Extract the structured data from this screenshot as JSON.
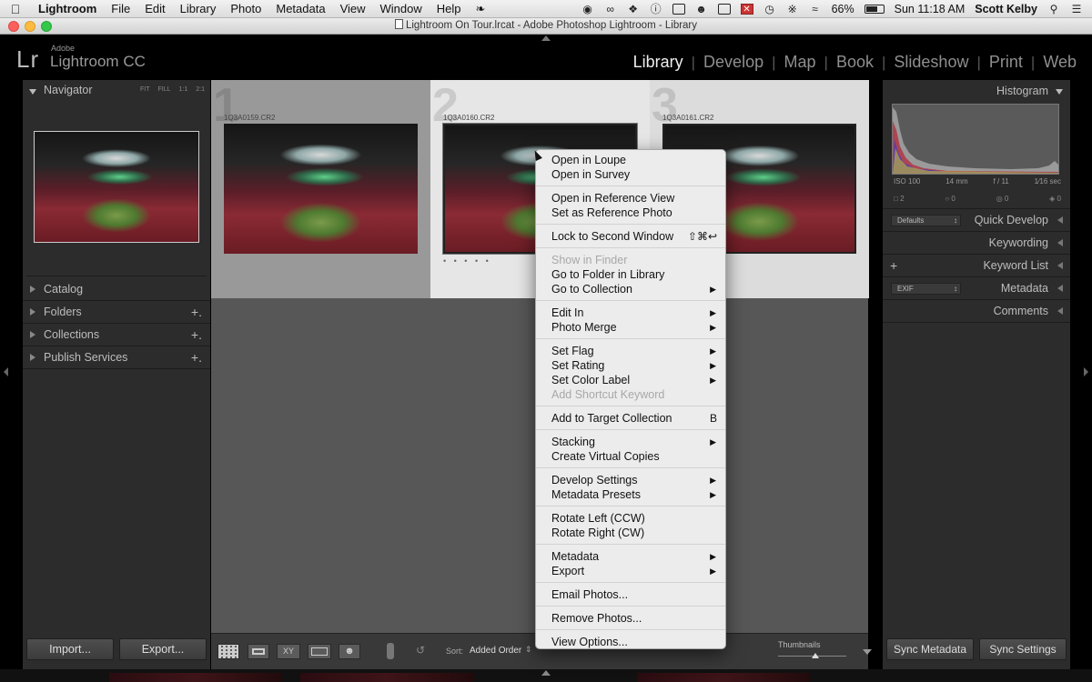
{
  "menubar": {
    "app": "Lightroom",
    "items": [
      "File",
      "Edit",
      "Library",
      "Photo",
      "Metadata",
      "View",
      "Window",
      "Help"
    ],
    "battery": "66%",
    "clock": "Sun 11:18 AM",
    "user": "Scott Kelby"
  },
  "window": {
    "title": "Lightroom On Tour.lrcat - Adobe Photoshop Lightroom - Library"
  },
  "identity": {
    "logo": "Lr",
    "adobe": "Adobe",
    "product": "Lightroom CC"
  },
  "modules": [
    "Library",
    "Develop",
    "Map",
    "Book",
    "Slideshow",
    "Print",
    "Web"
  ],
  "active_module": "Library",
  "left_panel": {
    "navigator": {
      "title": "Navigator",
      "zoom": [
        "FIT",
        "FILL",
        "1:1",
        "2:1"
      ]
    },
    "sections": [
      {
        "label": "Catalog",
        "plus": ""
      },
      {
        "label": "Folders",
        "plus": "+."
      },
      {
        "label": "Collections",
        "plus": "+."
      },
      {
        "label": "Publish Services",
        "plus": "+."
      }
    ],
    "import_label": "Import...",
    "export_label": "Export..."
  },
  "grid": {
    "cells": [
      {
        "index": "1",
        "filename": "1Q3A0159.CR2",
        "dots": ""
      },
      {
        "index": "2",
        "filename": "1Q3A0160.CR2",
        "dots": "• • • • •"
      },
      {
        "index": "3",
        "filename": "1Q3A0161.CR2",
        "dots": ""
      }
    ]
  },
  "toolbar": {
    "sort_label": "Sort:",
    "sort_value": "Added Order",
    "thumbnails_label": "Thumbnails"
  },
  "right_panel": {
    "histogram": {
      "title": "Histogram",
      "exif": [
        "ISO 100",
        "14 mm",
        "f / 11",
        "1⁄16 sec"
      ],
      "tools": [
        "2",
        "0",
        "0",
        "0"
      ]
    },
    "quick_develop": {
      "title": "Quick Develop",
      "preset": "Defaults"
    },
    "keywording": "Keywording",
    "keyword_list": "Keyword List",
    "metadata": {
      "title": "Metadata",
      "preset": "EXIF"
    },
    "comments": "Comments",
    "sync_metadata_label": "Sync Metadata",
    "sync_settings_label": "Sync Settings"
  },
  "context_menu": {
    "groups": [
      [
        {
          "label": "Open in Loupe"
        },
        {
          "label": "Open in Survey"
        }
      ],
      [
        {
          "label": "Open in Reference View"
        },
        {
          "label": "Set as Reference Photo"
        }
      ],
      [
        {
          "label": "Lock to Second Window",
          "shortcut": "⇧⌘↩"
        }
      ],
      [
        {
          "label": "Show in Finder",
          "disabled": true
        },
        {
          "label": "Go to Folder in Library"
        },
        {
          "label": "Go to Collection",
          "submenu": true
        }
      ],
      [
        {
          "label": "Edit In",
          "submenu": true
        },
        {
          "label": "Photo Merge",
          "submenu": true
        }
      ],
      [
        {
          "label": "Set Flag",
          "submenu": true
        },
        {
          "label": "Set Rating",
          "submenu": true
        },
        {
          "label": "Set Color Label",
          "submenu": true
        },
        {
          "label": "Add Shortcut Keyword",
          "disabled": true
        }
      ],
      [
        {
          "label": "Add to Target Collection",
          "shortcut": "B"
        }
      ],
      [
        {
          "label": "Stacking",
          "submenu": true
        },
        {
          "label": "Create Virtual Copies"
        }
      ],
      [
        {
          "label": "Develop Settings",
          "submenu": true
        },
        {
          "label": "Metadata Presets",
          "submenu": true
        }
      ],
      [
        {
          "label": "Rotate Left (CCW)"
        },
        {
          "label": "Rotate Right (CW)"
        }
      ],
      [
        {
          "label": "Metadata",
          "submenu": true
        },
        {
          "label": "Export",
          "submenu": true
        }
      ],
      [
        {
          "label": "Email Photos..."
        }
      ],
      [
        {
          "label": "Remove Photos..."
        }
      ],
      [
        {
          "label": "View Options..."
        }
      ]
    ]
  },
  "colors": {
    "panel_bg": "#2c2c2c",
    "grid_bg": "#575757",
    "selected_cell": "#e6e6e6",
    "cell_bg": "#9a9a9a",
    "menu_bg": "#ececec"
  }
}
